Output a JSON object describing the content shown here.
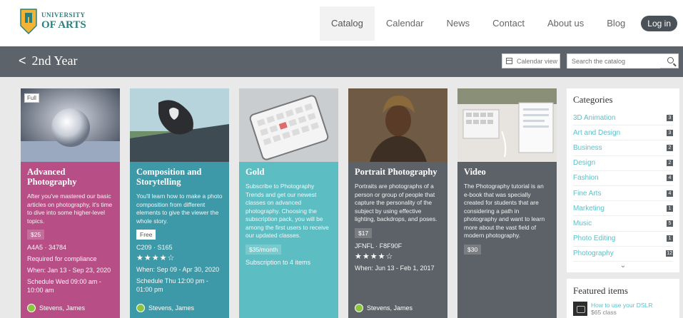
{
  "header": {
    "logo_line1": "UNIVERSITY",
    "logo_line2": "OF ARTS",
    "nav": [
      "Catalog",
      "Calendar",
      "News",
      "Contact",
      "About us",
      "Blog"
    ],
    "login": "Log in"
  },
  "titlebar": {
    "back_glyph": "<",
    "title": "2nd Year",
    "calendar_view": "Calendar view",
    "search_placeholder": "Search the catalog"
  },
  "cards": [
    {
      "badge": "Full",
      "title": "Advanced Photography",
      "description": "After you've mastered our basic articles on photography, it's time to dive into some higher-level topics.",
      "price": "$25",
      "code": "A4A5 · 34784",
      "note": "Required for compliance",
      "when": "When: Jan 13 - Sep 23, 2020",
      "schedule": "Schedule Wed 09:00 am - 10:00 am",
      "author": "Stevens, James",
      "color": "#b74f86"
    },
    {
      "title": "Composition and Storytelling",
      "description": "You'll learn how to make a photo composition from different elements to give the viewer the whole story.",
      "price": "Free",
      "code": "C209 · S165",
      "stars": "★★★★☆",
      "when": "When: Sep 09 - Apr 30, 2020",
      "schedule": "Schedule Thu 12:00 pm - 01:00 pm",
      "author": "Stevens, James",
      "color": "#3d99a8"
    },
    {
      "title": "Gold",
      "description": "Subscribe to Photography Trends and get our newest classes on advanced photography. Choosing the subscription pack, you will be among the first users to receive our updated classes.",
      "price": "$35/month",
      "note": "Subscription to 4 items",
      "color": "#5cbdc3"
    },
    {
      "title": "Portrait Photography",
      "description": "Portraits are photographs of a person or group of people that capture the personality of the subject by using effective lighting, backdrops, and poses.",
      "price": "$17",
      "code": "JFNFL · F8F90F",
      "stars": "★★★★☆",
      "when": "When: Jun 13 - Feb 1, 2017",
      "author": "Stevens, James",
      "color": "#5d6268"
    },
    {
      "title": "Video",
      "description": "The Photography tutorial is an e-book that was specially created for students that are considering a path in photography and want to learn more about the vast field of modern photography.",
      "price": "$30",
      "color": "#5d6268"
    }
  ],
  "sidebar": {
    "categories_title": "Categories",
    "categories": [
      {
        "name": "3D Animation",
        "count": "3"
      },
      {
        "name": "Art and Design",
        "count": "3"
      },
      {
        "name": "Business",
        "count": "2"
      },
      {
        "name": "Design",
        "count": "2"
      },
      {
        "name": "Fashion",
        "count": "4"
      },
      {
        "name": "Fine Arts",
        "count": "4"
      },
      {
        "name": "Marketing",
        "count": "1"
      },
      {
        "name": "Music",
        "count": "5"
      },
      {
        "name": "Photo Editing",
        "count": "1"
      },
      {
        "name": "Photography",
        "count": "12"
      }
    ],
    "more_glyph": "⌄",
    "featured_title": "Featured items",
    "featured": [
      {
        "title": "How to use your DSLR",
        "price": "$65 class"
      }
    ]
  },
  "colors": {
    "accent": "#5bc0c9",
    "titlebar": "#5c636a",
    "brand": "#2a7f80",
    "crest": "#f1b434"
  }
}
